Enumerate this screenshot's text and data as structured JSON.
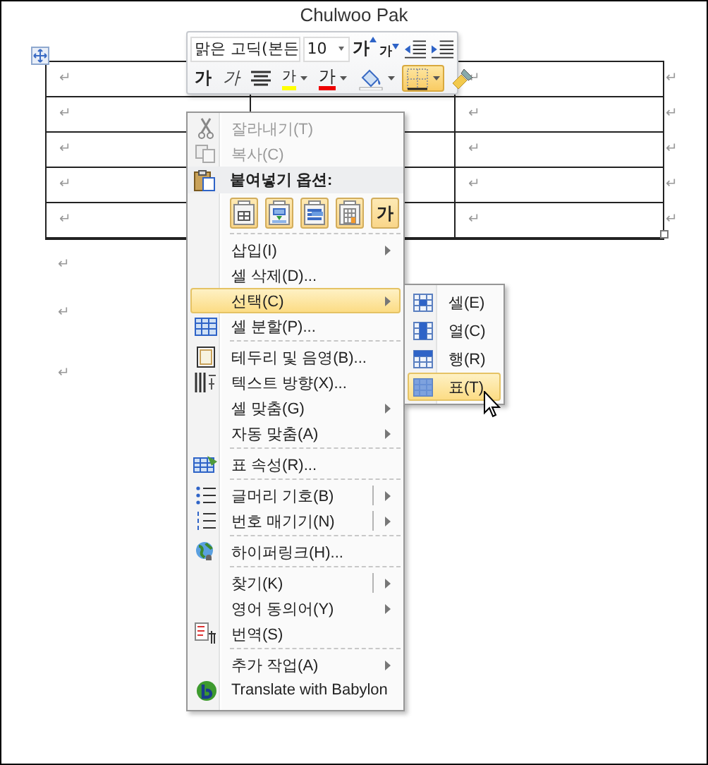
{
  "document": {
    "title": "Chulwoo Pak",
    "table": {
      "rows": [
        {
          "cells": [
            "↵",
            "↵"
          ],
          "end": "↵"
        },
        {
          "cells": [
            "↵",
            "↵"
          ],
          "end": "↵"
        },
        {
          "cells": [
            "↵",
            "↵"
          ],
          "end": "↵"
        },
        {
          "cells": [
            "↵",
            "↵"
          ],
          "end": "↵"
        },
        {
          "cells": [
            "↵",
            "↵"
          ],
          "end": "↵"
        }
      ]
    },
    "paragraphs": [
      "↵",
      "↵",
      "↵"
    ]
  },
  "mini_toolbar": {
    "font": {
      "value": "맑은 고딕(본든"
    },
    "size": {
      "value": "10"
    },
    "row1": [
      {
        "kind": "grow",
        "label": "가"
      },
      {
        "kind": "shrink",
        "label": "가"
      },
      {
        "kind": "outdent"
      },
      {
        "kind": "indent"
      }
    ],
    "row2": [
      {
        "kind": "bold",
        "label": "가",
        "dropdown": false,
        "selected": false
      },
      {
        "kind": "italic",
        "label": "가",
        "dropdown": false,
        "selected": false
      },
      {
        "kind": "center",
        "dropdown": false,
        "selected": false
      },
      {
        "kind": "highlight",
        "label": "가",
        "dropdown": true,
        "selected": false
      },
      {
        "kind": "font_color",
        "label": "가",
        "dropdown": true,
        "selected": false
      },
      {
        "kind": "shading",
        "dropdown": true,
        "selected": false
      },
      {
        "kind": "borders",
        "dropdown": true,
        "selected": true
      },
      {
        "kind": "painter",
        "dropdown": false,
        "selected": false
      }
    ]
  },
  "context_menu": {
    "items": [
      {
        "kind": "item",
        "label": "잘라내기(T)",
        "disabled": true,
        "selected": false,
        "submenu": false,
        "split": false
      },
      {
        "kind": "item",
        "label": "복사(C)",
        "disabled": true,
        "selected": false,
        "submenu": false,
        "split": false
      },
      {
        "kind": "header",
        "label": "붙여넣기 옵션:"
      },
      {
        "kind": "paste_options",
        "options": [
          {
            "kind": "table"
          },
          {
            "kind": "nest"
          },
          {
            "kind": "rows"
          },
          {
            "kind": "overwrite"
          },
          {
            "kind": "text",
            "label": "가"
          }
        ]
      },
      {
        "kind": "separator"
      },
      {
        "kind": "item",
        "label": "삽입(I)",
        "disabled": false,
        "selected": false,
        "submenu": true,
        "split": false
      },
      {
        "kind": "item",
        "label": "셀 삭제(D)...",
        "disabled": false,
        "selected": false,
        "submenu": false,
        "split": false
      },
      {
        "kind": "item",
        "label": "선택(C)",
        "disabled": false,
        "selected": true,
        "submenu": true,
        "split": false
      },
      {
        "kind": "item",
        "label": "셀 분할(P)...",
        "disabled": false,
        "selected": false,
        "submenu": false,
        "split": false
      },
      {
        "kind": "separator"
      },
      {
        "kind": "item",
        "label": "테두리 및 음영(B)...",
        "disabled": false,
        "selected": false,
        "submenu": false,
        "split": false
      },
      {
        "kind": "item",
        "label": "텍스트 방향(X)...",
        "disabled": false,
        "selected": false,
        "submenu": false,
        "split": false
      },
      {
        "kind": "item",
        "label": "셀 맞춤(G)",
        "disabled": false,
        "selected": false,
        "submenu": true,
        "split": false
      },
      {
        "kind": "item",
        "label": "자동 맞춤(A)",
        "disabled": false,
        "selected": false,
        "submenu": true,
        "split": false
      },
      {
        "kind": "separator"
      },
      {
        "kind": "item",
        "label": "표 속성(R)...",
        "disabled": false,
        "selected": false,
        "submenu": false,
        "split": false
      },
      {
        "kind": "separator"
      },
      {
        "kind": "item",
        "label": "글머리 기호(B)",
        "disabled": false,
        "selected": false,
        "submenu": true,
        "split": true
      },
      {
        "kind": "item",
        "label": "번호 매기기(N)",
        "disabled": false,
        "selected": false,
        "submenu": true,
        "split": true
      },
      {
        "kind": "separator"
      },
      {
        "kind": "item",
        "label": "하이퍼링크(H)...",
        "disabled": false,
        "selected": false,
        "submenu": false,
        "split": false
      },
      {
        "kind": "separator"
      },
      {
        "kind": "item",
        "label": "찾기(K)",
        "disabled": false,
        "selected": false,
        "submenu": true,
        "split": true
      },
      {
        "kind": "item",
        "label": "영어 동의어(Y)",
        "disabled": false,
        "selected": false,
        "submenu": true,
        "split": false
      },
      {
        "kind": "item",
        "label": "번역(S)",
        "disabled": false,
        "selected": false,
        "submenu": false,
        "split": false
      },
      {
        "kind": "separator"
      },
      {
        "kind": "item",
        "label": "추가 작업(A)",
        "disabled": false,
        "selected": false,
        "submenu": true,
        "split": false
      },
      {
        "kind": "item",
        "label": "Translate with Babylon",
        "disabled": false,
        "selected": false,
        "submenu": false,
        "split": false
      }
    ]
  },
  "submenu": {
    "items": [
      {
        "label": "셀(E)",
        "selected": false
      },
      {
        "label": "열(C)",
        "selected": false
      },
      {
        "label": "행(R)",
        "selected": false
      },
      {
        "label": "표(T)",
        "selected": true
      }
    ]
  }
}
